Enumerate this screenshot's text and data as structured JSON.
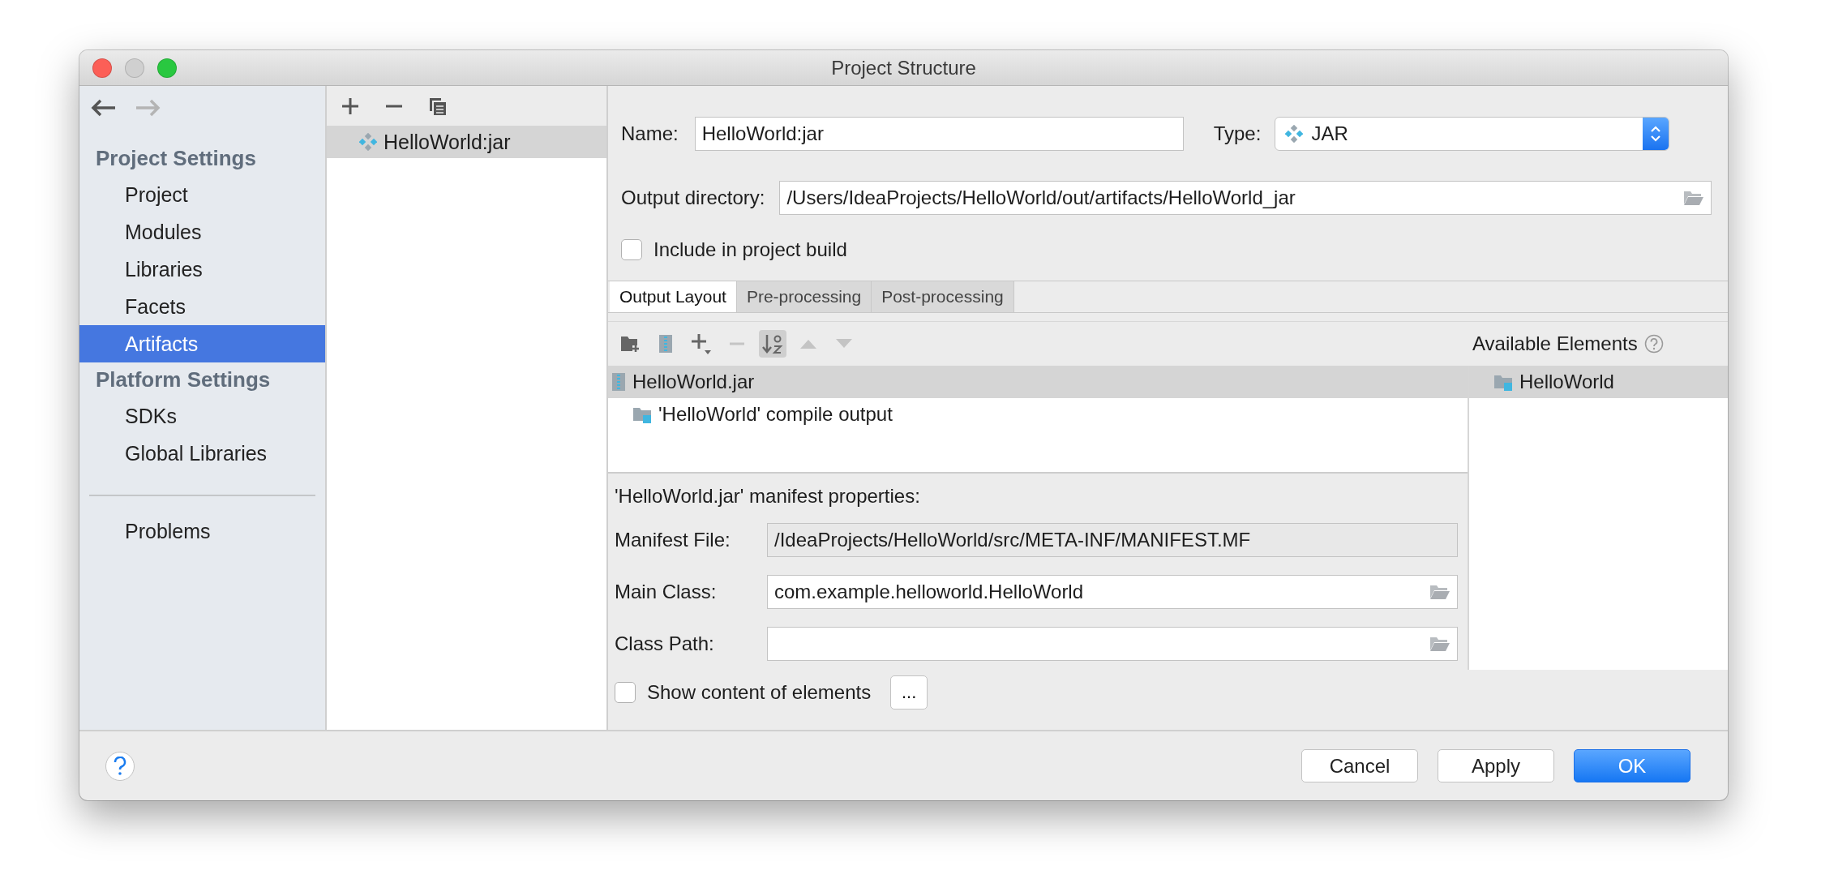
{
  "window": {
    "title": "Project Structure"
  },
  "sidebar": {
    "nav": [
      {
        "kind": "back",
        "disabled": false
      },
      {
        "kind": "forward",
        "disabled": true
      }
    ],
    "groups": [
      {
        "heading": "Project Settings",
        "items": [
          {
            "label": "Project",
            "selected": false
          },
          {
            "label": "Modules",
            "selected": false
          },
          {
            "label": "Libraries",
            "selected": false
          },
          {
            "label": "Facets",
            "selected": false
          },
          {
            "label": "Artifacts",
            "selected": true
          }
        ]
      },
      {
        "heading": "Platform Settings",
        "items": [
          {
            "label": "SDKs",
            "selected": false
          },
          {
            "label": "Global Libraries",
            "selected": false
          }
        ]
      }
    ],
    "extra_items": [
      {
        "label": "Problems",
        "selected": false
      }
    ]
  },
  "artifacts": [
    {
      "label": "HelloWorld:jar",
      "selected": true
    }
  ],
  "form": {
    "name_label": "Name:",
    "name_value": "HelloWorld:jar",
    "type_label": "Type:",
    "type_value": "JAR",
    "output_label": "Output directory:",
    "output_value": "/Users/IdeaProjects/HelloWorld/out/artifacts/HelloWorld_jar",
    "include": {
      "label": "Include in project build",
      "checked": false
    }
  },
  "tabs": [
    {
      "label": "Output Layout",
      "selected": true
    },
    {
      "label": "Pre-processing",
      "selected": false
    },
    {
      "label": "Post-processing",
      "selected": false
    }
  ],
  "layout_toolbar": [
    {
      "kind": "add-folder",
      "disabled": false,
      "on": false
    },
    {
      "kind": "archive",
      "disabled": false,
      "on": false
    },
    {
      "kind": "add",
      "disabled": false,
      "on": false
    },
    {
      "kind": "remove",
      "disabled": true,
      "on": false
    },
    {
      "kind": "sort",
      "disabled": false,
      "on": true
    },
    {
      "kind": "up",
      "disabled": true,
      "on": false
    },
    {
      "kind": "down",
      "disabled": true,
      "on": false
    }
  ],
  "layout_tree": [
    {
      "label": "HelloWorld.jar",
      "kind": "jar",
      "selected": true,
      "children": [
        {
          "label": "'HelloWorld' compile output",
          "kind": "module",
          "selected": false
        }
      ]
    }
  ],
  "available": {
    "title": "Available Elements",
    "items": [
      {
        "label": "HelloWorld",
        "selected": true
      }
    ]
  },
  "manifest": {
    "title": "'HelloWorld.jar' manifest properties:",
    "fields": [
      {
        "label": "Manifest File:",
        "value": "/IdeaProjects/HelloWorld/src/META-INF/MANIFEST.MF",
        "editable": false
      },
      {
        "label": "Main Class:",
        "value": "com.example.helloworld.HelloWorld",
        "editable": true
      },
      {
        "label": "Class Path:",
        "editable": true
      }
    ]
  },
  "show_content": {
    "label": "Show content of elements",
    "checked": false
  },
  "more_button": "...",
  "buttons": [
    {
      "label": "Cancel",
      "primary": false
    },
    {
      "label": "Apply",
      "primary": false
    },
    {
      "label": "OK",
      "primary": true
    }
  ]
}
